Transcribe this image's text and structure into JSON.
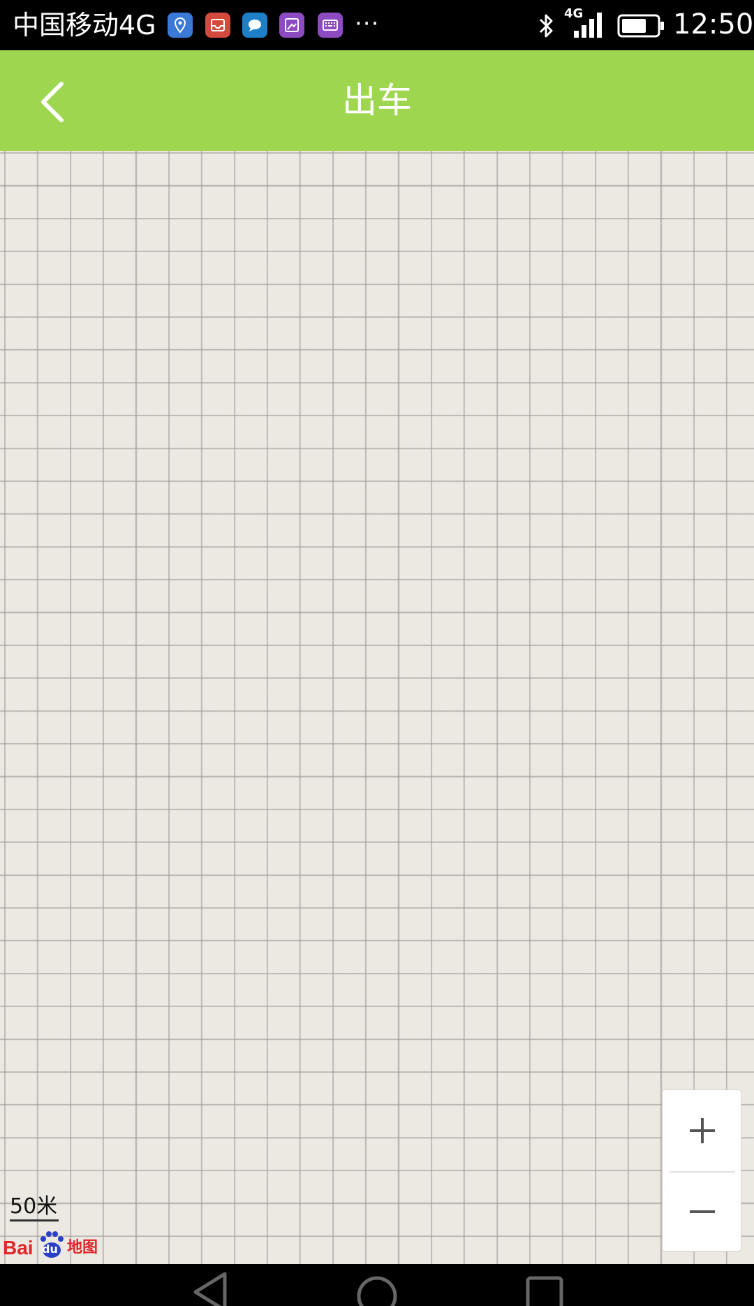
{
  "status_bar": {
    "carrier": "中国移动4G",
    "more": "···",
    "network_badge": "4G",
    "time": "12:50",
    "notification_icons": [
      {
        "name": "location-pin-icon",
        "color": "#3a79d6"
      },
      {
        "name": "inbox-icon",
        "color": "#d34b3c"
      },
      {
        "name": "chat-bubble-icon",
        "color": "#1d7fc7"
      },
      {
        "name": "image-edit-icon",
        "color": "#8c4bc0"
      },
      {
        "name": "keyboard-icon",
        "color": "#8c4bc0"
      }
    ]
  },
  "header": {
    "title": "出车",
    "background_color": "#9ed74f"
  },
  "map": {
    "scale_label": "50米",
    "attribution_bai": "Bai",
    "attribution_du": "du",
    "attribution_map": "地图",
    "background_color": "#ece8e2"
  },
  "zoom": {
    "in_icon": "plus-icon",
    "out_icon": "minus-icon"
  },
  "nav": {
    "back_icon": "triangle-back-icon",
    "home_icon": "circle-home-icon",
    "recents_icon": "square-recents-icon"
  }
}
